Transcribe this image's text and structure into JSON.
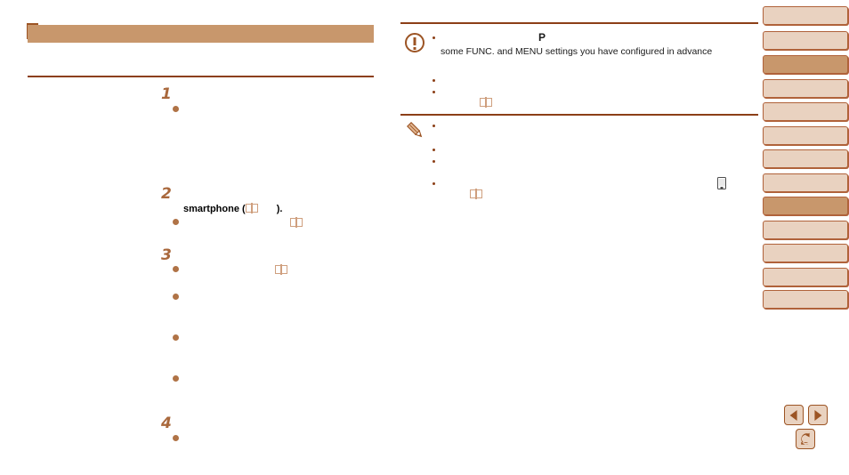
{
  "document": {
    "type": "camera-instruction-manual-page",
    "background_color": "#ffffff",
    "accent_color": "#8c3f17",
    "tab_color": "#e9d2c0",
    "tab_active_color": "#c8976c",
    "heading_bar_color": "#c8976c",
    "heading_marker_color": "#9c5424",
    "bullet_color": "#b07346",
    "step_number_color": "#a9683c"
  },
  "left_column": {
    "heading_bar": {
      "label": "",
      "marker": ""
    },
    "steps": [
      {
        "number": "1",
        "heading": "",
        "bullets": [
          {
            "text": ""
          }
        ]
      },
      {
        "number": "2",
        "heading": "smartphone (",
        "heading_icon": "book-icon",
        "heading_suffix": ").",
        "bullets": [
          {
            "text": "",
            "icon": "book-icon"
          }
        ]
      },
      {
        "number": "3",
        "heading": "",
        "bullets": [
          {
            "text": "",
            "icon": "book-icon"
          },
          {
            "text": ""
          },
          {
            "text": ""
          },
          {
            "text": ""
          }
        ]
      },
      {
        "number": "4",
        "heading": "",
        "bullets": [
          {
            "text": ""
          }
        ]
      }
    ]
  },
  "right_column": {
    "caution": {
      "icon": "exclamation-circle-icon",
      "bullets": [
        {
          "emphasis": "P",
          "text": "some FUNC. and MENU settings you have configured in advance"
        },
        {
          "text": ""
        },
        {
          "text": "",
          "icon": "book-icon"
        }
      ]
    },
    "note": {
      "icon": "pencil-note-icon",
      "bullets": [
        {
          "text": ""
        },
        {
          "text": ""
        },
        {
          "text": ""
        },
        {
          "text": "",
          "icon": "book-icon",
          "trailing_icon": "smartphone-icon"
        }
      ]
    }
  },
  "side_tabs": [
    {
      "label": "",
      "active": false
    },
    {
      "label": "",
      "active": false
    },
    {
      "label": "",
      "active": true
    },
    {
      "label": "",
      "active": false
    },
    {
      "label": "",
      "active": false
    },
    {
      "label": "",
      "active": false
    },
    {
      "label": "",
      "active": false
    },
    {
      "label": "",
      "active": true
    },
    {
      "label": "",
      "active": false
    },
    {
      "label": "",
      "active": false
    },
    {
      "label": "",
      "active": false
    },
    {
      "label": "",
      "active": false
    }
  ],
  "navigation": {
    "previous_label": "",
    "previous_icon": "triangle-left-icon",
    "next_label": "",
    "next_icon": "triangle-right-icon",
    "home_label": "",
    "home_icon": "return-arrow-icon"
  }
}
